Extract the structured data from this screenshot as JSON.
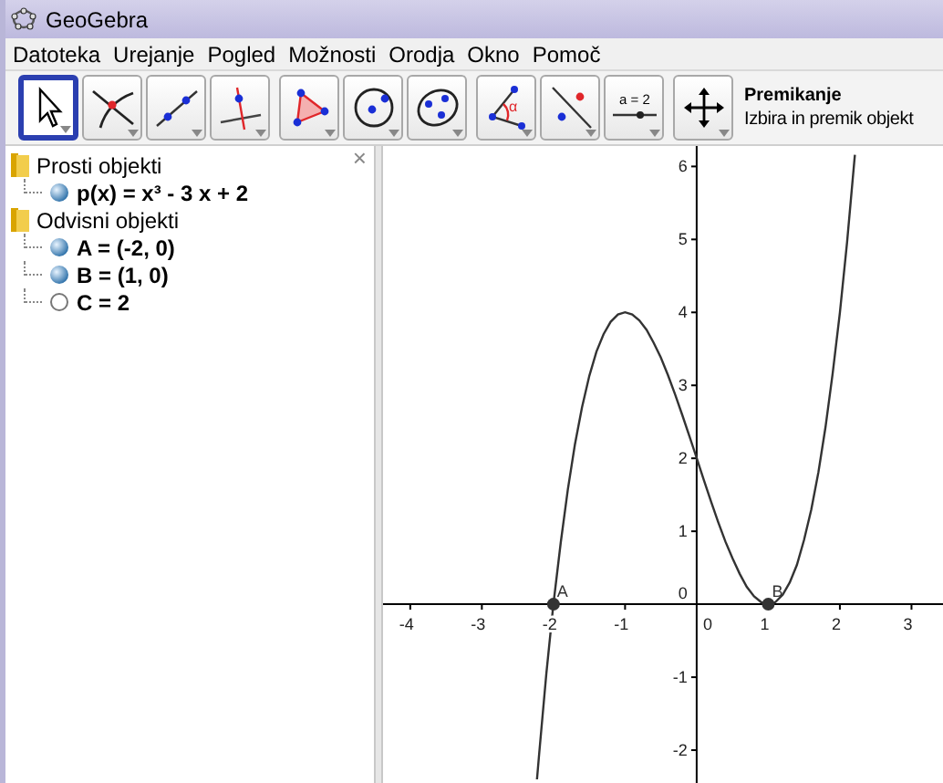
{
  "window": {
    "title": "GeoGebra"
  },
  "menu": [
    "Datoteka",
    "Urejanje",
    "Pogled",
    "Možnosti",
    "Orodja",
    "Okno",
    "Pomoč"
  ],
  "toolbar": {
    "tools": [
      {
        "kind": "move",
        "selected": true
      },
      {
        "kind": "intersect",
        "selected": false
      },
      {
        "kind": "line",
        "selected": false
      },
      {
        "kind": "perpendicular",
        "selected": false
      },
      {
        "kind": "polygon",
        "selected": false
      },
      {
        "kind": "circle",
        "selected": false
      },
      {
        "kind": "conic",
        "selected": false
      },
      {
        "kind": "angle",
        "label": "α",
        "selected": false
      },
      {
        "kind": "reflect",
        "selected": false
      },
      {
        "kind": "slider",
        "label": "a = 2",
        "selected": false
      },
      {
        "kind": "move-view",
        "selected": false
      }
    ],
    "tool_name": "Premikanje",
    "tool_help": "Izbira in premik objekt"
  },
  "algebra_view": {
    "close_label": "×",
    "folders": [
      {
        "label": "Prosti objekti",
        "children": [
          {
            "label": "p(x) = x³ - 3 x + 2",
            "visible": true
          }
        ]
      },
      {
        "label": "Odvisni objekti",
        "children": [
          {
            "label": "A = (-2, 0)",
            "visible": true
          },
          {
            "label": "B = (1, 0)",
            "visible": true
          },
          {
            "label": "C = 2",
            "visible": false
          }
        ]
      }
    ]
  },
  "graphics_view": {
    "origin_labels": [
      "0",
      "0"
    ],
    "chart_data": {
      "type": "line",
      "xlim": [
        -4.38,
        3.44
      ],
      "ylim": [
        -2.45,
        6.28
      ],
      "xticks": [
        -4,
        -3,
        -2,
        -1,
        1,
        2,
        3
      ],
      "yticks": [
        -2,
        -1,
        1,
        2,
        3,
        4,
        5,
        6
      ],
      "x": [
        -2.23,
        -2.2,
        -2.1,
        -2.0,
        -1.9,
        -1.8,
        -1.7,
        -1.6,
        -1.5,
        -1.4,
        -1.3,
        -1.2,
        -1.1,
        -1.0,
        -0.9,
        -0.8,
        -0.7,
        -0.6,
        -0.5,
        -0.4,
        -0.3,
        -0.2,
        -0.1,
        0,
        0.1,
        0.2,
        0.3,
        0.4,
        0.5,
        0.6,
        0.7,
        0.8,
        0.9,
        1.0,
        1.1,
        1.2,
        1.3,
        1.4,
        1.5,
        1.6,
        1.7,
        1.8,
        1.9,
        2.0,
        2.1,
        2.2,
        2.21
      ],
      "series": [
        {
          "color": "#333333",
          "values": [
            -2.4,
            -2.05,
            -0.96,
            0,
            0.84,
            1.57,
            2.19,
            2.7,
            3.13,
            3.46,
            3.7,
            3.87,
            3.97,
            4,
            3.97,
            3.89,
            3.76,
            3.58,
            3.38,
            3.14,
            2.87,
            2.59,
            2.3,
            2,
            1.7,
            1.41,
            1.13,
            0.86,
            0.63,
            0.42,
            0.24,
            0.11,
            0.03,
            0,
            0.03,
            0.13,
            0.3,
            0.54,
            0.88,
            1.3,
            1.81,
            2.43,
            3.16,
            4,
            4.96,
            6.05,
            6.16
          ]
        }
      ],
      "annotations": [
        {
          "text": "A",
          "x": -2,
          "y": 0
        },
        {
          "text": "B",
          "x": 1,
          "y": 0
        }
      ]
    }
  }
}
